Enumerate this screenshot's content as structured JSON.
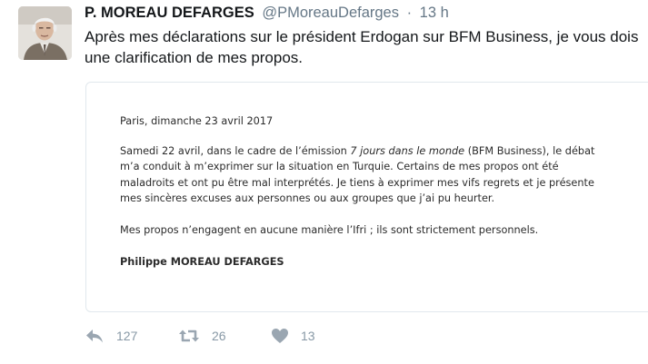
{
  "tweet": {
    "author": {
      "display_name": "P. MOREAU DEFARGES",
      "handle": "@PMoreauDefarges",
      "avatar": "avatar-photo"
    },
    "separator": "·",
    "timestamp": "13 h",
    "text": "Après mes déclarations sur le président Erdogan sur BFM Business, je vous dois une clarification de mes propos.",
    "media": {
      "date_line": "Paris, dimanche 23 avril 2017",
      "para1_before": "Samedi 22 avril, dans le cadre de l’émission ",
      "para1_emission": "7 jours dans le monde",
      "para1_line1_tail": " (BFM Business), le débat",
      "para1_line2": "m’a conduit à m’exprimer sur la situation en Turquie. Certains de mes propos ont été",
      "para1_line3": "maladroits et ont pu être mal interprétés. Je tiens à exprimer mes vifs regrets et je présente",
      "para1_line4": "mes sincères excuses aux personnes ou aux groupes que j’ai pu heurter.",
      "para2": "Mes propos n’engagent en aucune manière l’Ifri ; ils sont strictement personnels.",
      "signature": "Philippe MOREAU DEFARGES"
    },
    "actions": {
      "reply": {
        "icon": "reply-icon",
        "count": "127"
      },
      "retweet": {
        "icon": "retweet-icon",
        "count": "26"
      },
      "like": {
        "icon": "heart-icon",
        "count": "13"
      }
    },
    "colors": {
      "text": "#14171a",
      "secondary": "#657786",
      "action_icon": "#9aa6b1",
      "card_border": "#e1e8ed"
    }
  }
}
